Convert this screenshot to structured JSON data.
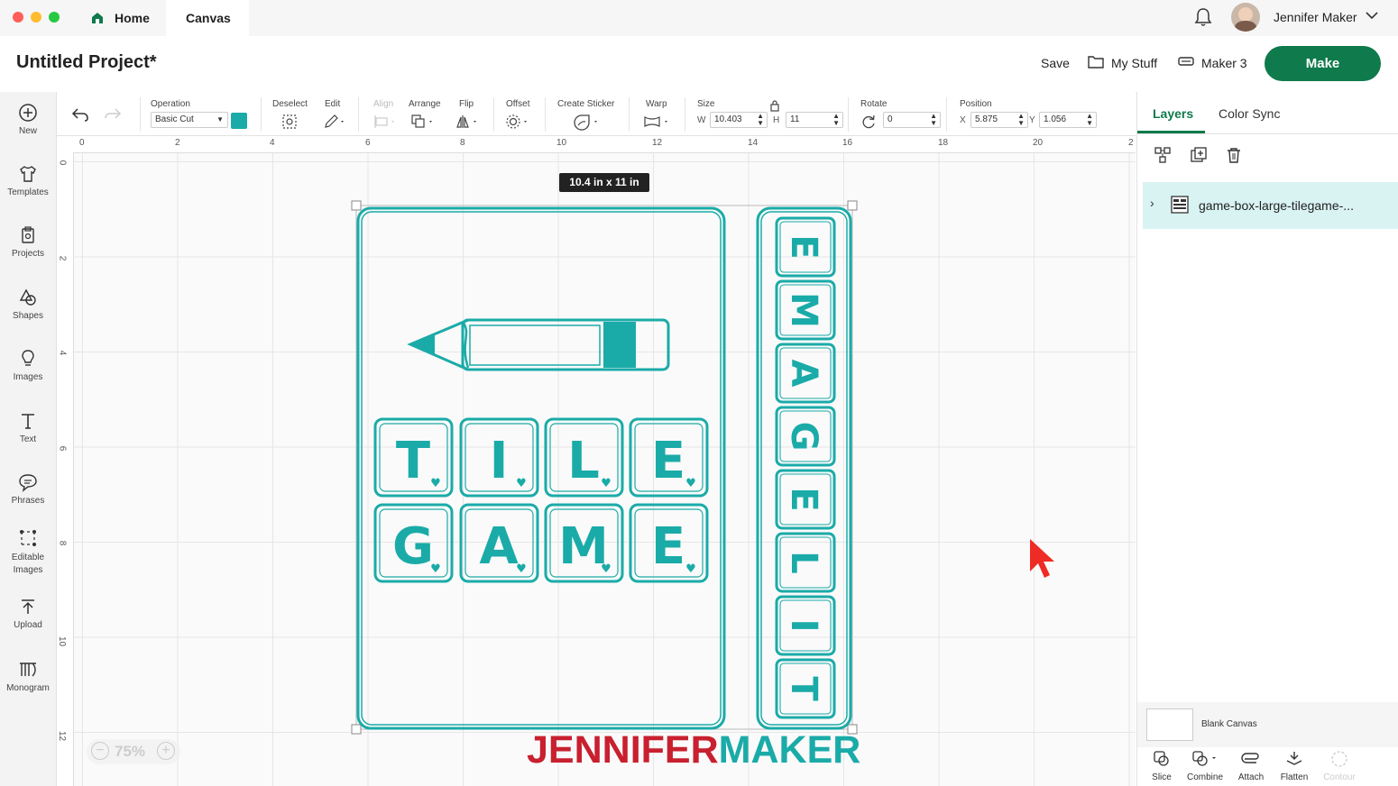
{
  "tabs": {
    "home": "Home",
    "canvas": "Canvas"
  },
  "user": {
    "name": "Jennifer Maker"
  },
  "project": {
    "title": "Untitled Project*"
  },
  "header_actions": {
    "save": "Save",
    "my_stuff": "My Stuff",
    "machine": "Maker 3",
    "make": "Make"
  },
  "sidebar": {
    "items": [
      {
        "label": "New",
        "icon": "plus-circle-icon"
      },
      {
        "label": "Templates",
        "icon": "shirt-icon"
      },
      {
        "label": "Projects",
        "icon": "projects-icon"
      },
      {
        "label": "Shapes",
        "icon": "shapes-icon"
      },
      {
        "label": "Images",
        "icon": "lightbulb-icon"
      },
      {
        "label": "Text",
        "icon": "text-icon"
      },
      {
        "label": "Phrases",
        "icon": "speech-bubble-icon"
      },
      {
        "label": "Editable Images",
        "icon": "editable-images-icon"
      },
      {
        "label": "Upload",
        "icon": "upload-icon"
      },
      {
        "label": "Monogram",
        "icon": "monogram-icon"
      }
    ]
  },
  "toolbar": {
    "operation_label": "Operation",
    "operation_value": "Basic Cut",
    "operation_color": "#1aaba8",
    "deselect_label": "Deselect",
    "edit_label": "Edit",
    "align_label": "Align",
    "arrange_label": "Arrange",
    "flip_label": "Flip",
    "offset_label": "Offset",
    "create_sticker_label": "Create Sticker",
    "warp_label": "Warp",
    "size_label": "Size",
    "w_label": "W",
    "w_value": "10.403",
    "h_label": "H",
    "h_value": "11",
    "rotate_label": "Rotate",
    "rotate_value": "0",
    "position_label": "Position",
    "x_label": "X",
    "x_value": "5.875",
    "y_label": "Y",
    "y_value": "1.056"
  },
  "ruler": {
    "top": [
      "0",
      "2",
      "4",
      "6",
      "8",
      "10",
      "12",
      "14",
      "16",
      "18",
      "20",
      "2"
    ],
    "left": [
      "0",
      "2",
      "4",
      "6",
      "8",
      "10",
      "12"
    ]
  },
  "canvas": {
    "size_tooltip": "10.4  in x 11  in",
    "zoom": "75%",
    "accent": "#1aaba8",
    "tiles_row1": [
      "T",
      "I",
      "L",
      "E"
    ],
    "tiles_row2": [
      "G",
      "A",
      "M",
      "E"
    ],
    "side_tiles": [
      "E",
      "M",
      "A",
      "G",
      "E",
      "L",
      "I",
      "T"
    ],
    "watermark": {
      "part1": "JENNIFER",
      "part2": "MAKER",
      "color1": "#c8202f",
      "color2": "#1aaba8"
    }
  },
  "panel": {
    "tabs": [
      "Layers",
      "Color Sync"
    ],
    "layer_name": "game-box-large-tilegame-...",
    "blank_canvas": "Blank Canvas",
    "bottom_tools": [
      "Slice",
      "Combine",
      "Attach",
      "Flatten",
      "Contour"
    ]
  },
  "colors": {
    "make_button": "#0f7a4b",
    "selected_layer": "#d8f3f2",
    "cursor": "#ee2b24"
  }
}
